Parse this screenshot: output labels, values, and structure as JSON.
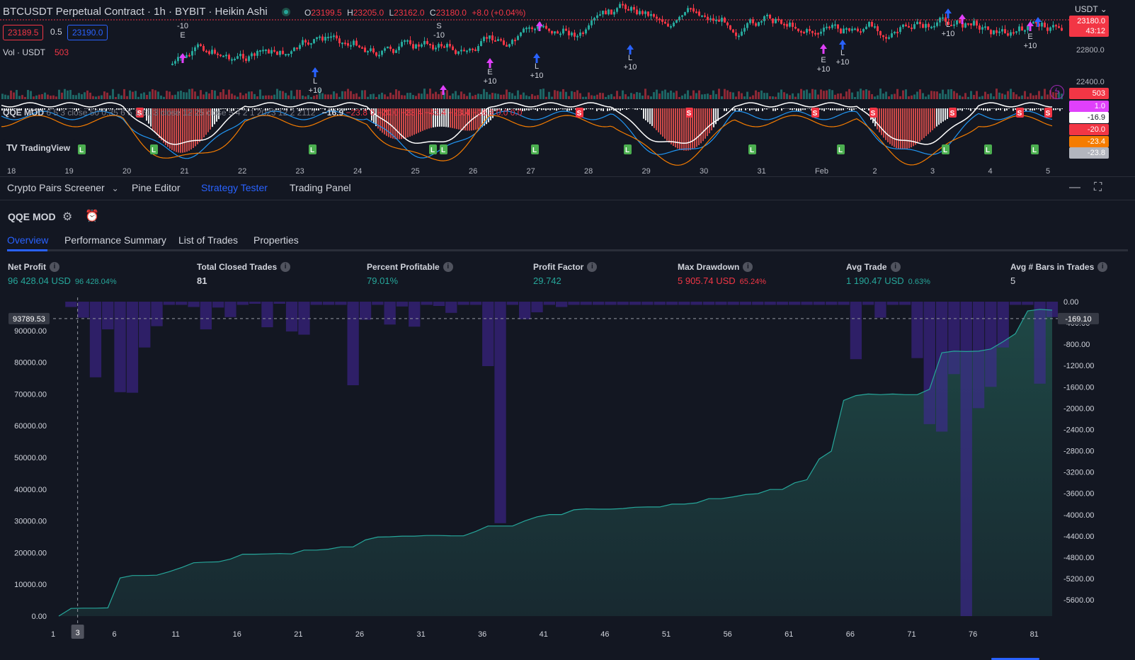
{
  "header": {
    "symbol_title": "BTCUSDT Perpetual Contract · 1h · BYBIT · Heikin Ashi",
    "ohlc": {
      "o_label": "O",
      "o": "23199.5",
      "h_label": "H",
      "h": "23205.0",
      "l_label": "L",
      "l": "23162.0",
      "c_label": "C",
      "c": "23180.0",
      "change": "+8.0 (+0.04%)"
    },
    "sell_price": "23189.5",
    "spread": "0.5",
    "buy_price": "23190.0",
    "volume_label": "Vol · USDT",
    "volume_value": "503",
    "qqe_indicator": {
      "name": "QQE MOD",
      "params": "6 5 3 close 50 0.35 6 5 1.61 3 close 12 25 close 5 4 2 1 2023 12 2 2112",
      "v1": "−16.9",
      "v2": "−23.8",
      "v3": "0",
      "rest": "−20.0  −23.4  −43.4  −23.4  −16.9  0.0  0.0"
    },
    "tv_logo": "TradingView",
    "currency_selector": "USDT",
    "alert_icon": "lightning-icon",
    "colors": {
      "bull": "#26a69a",
      "bear": "#f23645",
      "accent": "#2962ff",
      "signal_long": "#2962ff",
      "signal_exit": "#e040fb"
    }
  },
  "top_chart": {
    "price_axis": [
      "22800.0",
      "22400.0"
    ],
    "price_badges": [
      {
        "text": "23180.0",
        "color": "#f23645"
      },
      {
        "text": "43:12",
        "color": "#f23645"
      },
      {
        "text": "503",
        "color": "#f23645"
      },
      {
        "text": "1.0",
        "color": "#e040fb"
      },
      {
        "text": "-16.9",
        "color": "#ffffff"
      },
      {
        "text": "-20.0",
        "color": "#f23645"
      },
      {
        "text": "-23.4",
        "color": "#f57c00"
      },
      {
        "text": "-23.8",
        "color": "#b2b5be"
      }
    ],
    "day_labels": [
      "18",
      "19",
      "20",
      "21",
      "22",
      "23",
      "24",
      "25",
      "26",
      "27",
      "28",
      "29",
      "30",
      "31",
      "Feb",
      "2",
      "3",
      "4",
      "5"
    ],
    "trade_annotations": [
      {
        "text": "-10",
        "sub": "E"
      },
      {
        "text": "L",
        "sub": "+10"
      },
      {
        "text": "S",
        "sub": "-10"
      },
      {
        "text": "E",
        "sub": "+10"
      },
      {
        "text": "L",
        "sub": "+10"
      },
      {
        "text": "L",
        "sub": "+10"
      },
      {
        "text": "E",
        "sub": "+10"
      },
      {
        "text": "L",
        "sub": "+10"
      },
      {
        "text": "L",
        "sub": "+10"
      },
      {
        "text": "E",
        "sub": "+10"
      }
    ],
    "signal_tags": {
      "long": "L",
      "short": "S"
    }
  },
  "panel": {
    "tabs": [
      "Crypto Pairs Screener",
      "Pine Editor",
      "Strategy Tester",
      "Trading Panel"
    ],
    "active_tab": "Strategy Tester",
    "strategy_name": "QQE MOD",
    "sub_tabs": [
      "Overview",
      "Performance Summary",
      "List of Trades",
      "Properties"
    ],
    "active_sub_tab": "Overview",
    "metrics": [
      {
        "label": "Net Profit",
        "value": "96 428.04 USD",
        "pct": "96 428.04%",
        "color": "green"
      },
      {
        "label": "Total Closed Trades",
        "value": "81",
        "pct": "",
        "color": "white"
      },
      {
        "label": "Percent Profitable",
        "value": "79.01%",
        "pct": "",
        "color": "green"
      },
      {
        "label": "Profit Factor",
        "value": "29.742",
        "pct": "",
        "color": "green"
      },
      {
        "label": "Max Drawdown",
        "value": "5 905.74 USD",
        "pct": "65.24%",
        "color": "red"
      },
      {
        "label": "Avg Trade",
        "value": "1 190.47 USD",
        "pct": "0.63%",
        "color": "green"
      },
      {
        "label": "Avg # Bars in Trades",
        "value": "5",
        "pct": "",
        "color": "white"
      }
    ]
  },
  "chart_data": {
    "type": "area",
    "title": "",
    "series": [
      {
        "name": "",
        "type": "area",
        "axis": "left",
        "x": [
          1,
          2,
          3,
          4,
          5,
          6,
          7,
          8,
          9,
          10,
          11,
          12,
          13,
          14,
          15,
          16,
          17,
          18,
          19,
          20,
          21,
          22,
          23,
          24,
          25,
          26,
          27,
          28,
          29,
          30,
          31,
          32,
          33,
          34,
          35,
          36,
          37,
          38,
          39,
          40,
          41,
          42,
          43,
          44,
          45,
          46,
          47,
          48,
          49,
          50,
          51,
          52,
          53,
          54,
          55,
          56,
          57,
          58,
          59,
          60,
          61,
          62,
          63,
          64,
          65,
          66,
          67,
          68,
          69,
          70,
          71,
          72,
          73,
          74,
          75,
          76,
          77,
          78,
          79,
          80,
          81,
          82
        ],
        "values": [
          0,
          2400,
          2500,
          2500,
          2600,
          12000,
          12800,
          12800,
          12900,
          14000,
          15300,
          16800,
          17000,
          17100,
          18000,
          19500,
          19500,
          19600,
          19700,
          19600,
          20800,
          20800,
          21100,
          21800,
          21800,
          24000,
          24900,
          25000,
          25200,
          25200,
          25400,
          25400,
          25300,
          25300,
          26700,
          28400,
          28400,
          28400,
          30000,
          31300,
          32000,
          32000,
          33500,
          33800,
          33700,
          33700,
          33900,
          34300,
          34400,
          34400,
          35300,
          35300,
          35700,
          37000,
          37000,
          37600,
          38300,
          38600,
          39900,
          39900,
          42000,
          43000,
          49500,
          52000,
          68000,
          69500,
          70000,
          69800,
          70000,
          69800,
          69800,
          71500,
          83000,
          83500,
          83400,
          83500,
          84200,
          86500,
          89000,
          96200,
          96700,
          96428
        ]
      },
      {
        "name": "",
        "type": "bar",
        "axis": "right",
        "x": [
          1,
          2,
          3,
          4,
          5,
          6,
          7,
          8,
          9,
          10,
          11,
          12,
          13,
          14,
          15,
          16,
          17,
          18,
          19,
          20,
          21,
          22,
          23,
          24,
          25,
          26,
          27,
          28,
          29,
          30,
          31,
          32,
          33,
          34,
          35,
          36,
          37,
          38,
          39,
          40,
          41,
          42,
          43,
          44,
          45,
          46,
          47,
          48,
          49,
          50,
          51,
          52,
          53,
          54,
          55,
          56,
          57,
          58,
          59,
          60,
          61,
          62,
          63,
          64,
          65,
          66,
          67,
          68,
          69,
          70,
          71,
          72,
          73,
          74,
          75,
          76,
          77,
          78,
          79,
          80,
          81,
          82
        ],
        "values": [
          0,
          -100,
          -300,
          -1420,
          -520,
          -1700,
          -1710,
          -860,
          -460,
          -60,
          -60,
          -100,
          -520,
          -110,
          -290,
          -60,
          -40,
          -480,
          -40,
          -560,
          -620,
          -60,
          -60,
          -60,
          -1570,
          -340,
          -60,
          -430,
          -90,
          -470,
          -60,
          -80,
          -210,
          -60,
          -60,
          -1210,
          -4160,
          -60,
          -330,
          -200,
          -60,
          -100,
          -60,
          -60,
          -60,
          -60,
          -60,
          -60,
          -60,
          -60,
          -60,
          -60,
          -60,
          -60,
          -60,
          -60,
          -60,
          -60,
          -60,
          -60,
          -60,
          -60,
          -60,
          -60,
          -60,
          -1080,
          -60,
          -300,
          -60,
          -60,
          -1060,
          -2300,
          -2440,
          -1360,
          -5905,
          -2000,
          -1600,
          -860,
          -60,
          -60,
          -1540,
          -290
        ]
      }
    ],
    "left_axis": {
      "ylim": [
        0,
        96428
      ],
      "ticks": [
        "0.00",
        "10000.00",
        "20000.00",
        "30000.00",
        "40000.00",
        "50000.00",
        "60000.00",
        "70000.00",
        "80000.00",
        "90000.00"
      ]
    },
    "right_axis": {
      "ylim": [
        -5905,
        0
      ],
      "ticks": [
        "0.00",
        "-400.00",
        "-800.00",
        "-1200.00",
        "-1600.00",
        "-2000.00",
        "-2400.00",
        "-2800.00",
        "-3200.00",
        "-3600.00",
        "-4000.00",
        "-4400.00",
        "-4800.00",
        "-5200.00",
        "-5600.00"
      ]
    },
    "x_ticks": [
      "1",
      "6",
      "11",
      "16",
      "21",
      "26",
      "31",
      "36",
      "41",
      "46",
      "51",
      "56",
      "61",
      "66",
      "71",
      "76",
      "81"
    ],
    "crosshair": {
      "x_label": "3",
      "left_value": "93789.53",
      "right_value": "-169.10"
    },
    "colors": {
      "equity_line": "#26a69a",
      "equity_fill": "#1d3b3a",
      "drawdown_bar": "#311b72"
    },
    "grid": false
  }
}
